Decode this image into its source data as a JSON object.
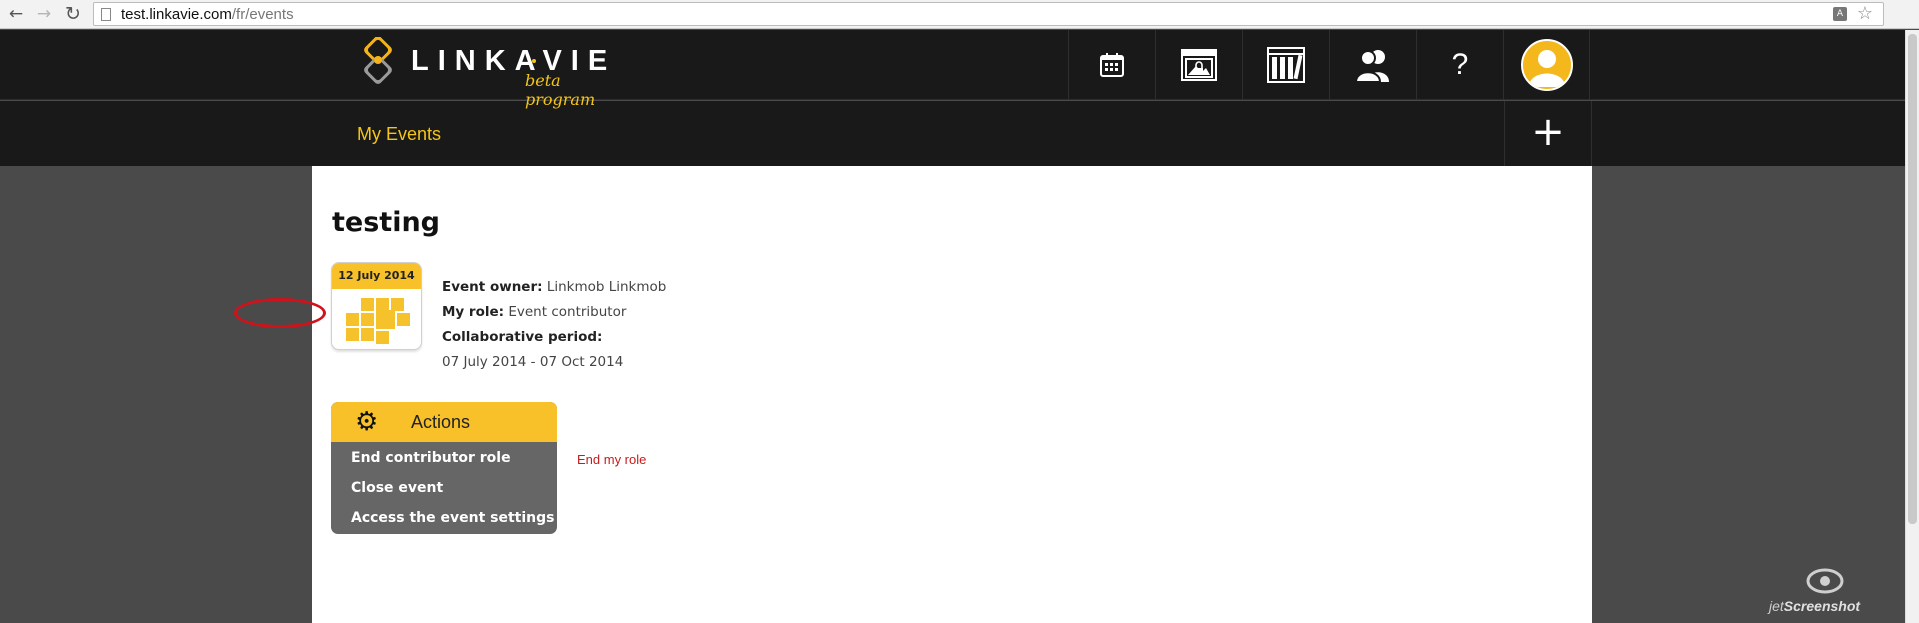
{
  "browser": {
    "url_domain": "test.linkavie.com",
    "url_path": "/fr/events",
    "back_icon": "←",
    "forward_icon": "→",
    "reload_icon": "↻",
    "star_icon": "☆"
  },
  "site": {
    "logo_text": "LINKAVIE",
    "logo_sub": "beta program",
    "help_label": "?",
    "nav_icons": [
      "calendar-icon",
      "gallery-lock-icon",
      "library-icon",
      "contacts-icon",
      "help-icon",
      "avatar"
    ]
  },
  "subnav": {
    "title": "My Events",
    "add_label": "+"
  },
  "event": {
    "title": "testing",
    "date_badge": "12 July 2014",
    "owner_label": "Event owner:",
    "owner_value": "Linkmob Linkmob",
    "role_label": "My role:",
    "role_value": "Event contributor",
    "period_label": "Collaborative period:",
    "period_value": "07 July 2014 - 07 Oct 2014"
  },
  "actions": {
    "title": "Actions",
    "items": [
      "End contributor role",
      "Close event",
      "Access the event settings"
    ]
  },
  "annotation": {
    "end_role_text": "End my role"
  },
  "watermark": {
    "prefix": "jet",
    "brand": "Screenshot"
  },
  "colors": {
    "accent": "#f8c12a",
    "header_bg": "#191919",
    "page_bg": "#4a4a4a",
    "annotation_red": "#d0121b"
  }
}
